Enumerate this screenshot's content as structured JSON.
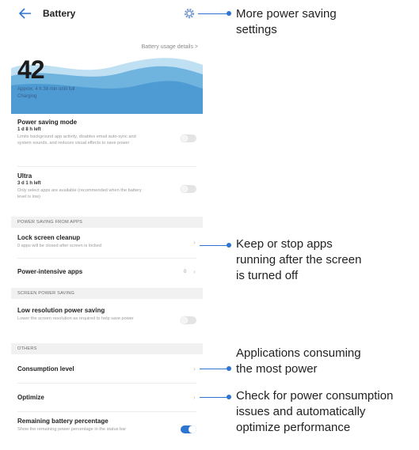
{
  "header": {
    "title": "Battery"
  },
  "usage_link": "Battery usage details  >",
  "hero": {
    "percent": "42",
    "approx": "Approx. 4 h 38 min until full",
    "status": "Charging"
  },
  "power_saving_mode": {
    "label": "Power saving mode",
    "time_left": "1 d 8 h left",
    "description": "Limits background app activity, disables email auto-sync and system sounds, and reduces visual effects to save power"
  },
  "ultra": {
    "label": "Ultra",
    "time_left": "3 d 1 h left",
    "description": "Only select apps are available (recommended when the battery level is low)"
  },
  "section_apps": "POWER SAVING FROM APPS",
  "lock_screen_cleanup": {
    "label": "Lock screen cleanup",
    "description": "0 apps will be closed after screen is locked"
  },
  "power_intensive_apps": {
    "label": "Power-intensive apps",
    "value": "0"
  },
  "section_screen": "SCREEN POWER SAVING",
  "low_resolution": {
    "label": "Low resolution power saving",
    "description": "Lower the screen resolution as required to help save power"
  },
  "section_others": "OTHERS",
  "consumption_level": {
    "label": "Consumption level"
  },
  "optimize": {
    "label": "Optimize"
  },
  "remaining_pct": {
    "label": "Remaining battery percentage",
    "description": "Show the remaining power percentage in the status bar",
    "enabled": true
  },
  "callouts": {
    "settings_1": "More power saving",
    "settings_2": "settings",
    "lock_1": "Keep or stop apps",
    "lock_2": "running after the screen",
    "lock_3": "is turned off",
    "consumption_1": "Applications consuming",
    "consumption_2": "the most power",
    "optimize_1": "Check for power consumption",
    "optimize_2": "issues and automatically",
    "optimize_3": "optimize performance"
  },
  "colors": {
    "accent": "#2e74d1",
    "wave": "#5aa6db"
  }
}
